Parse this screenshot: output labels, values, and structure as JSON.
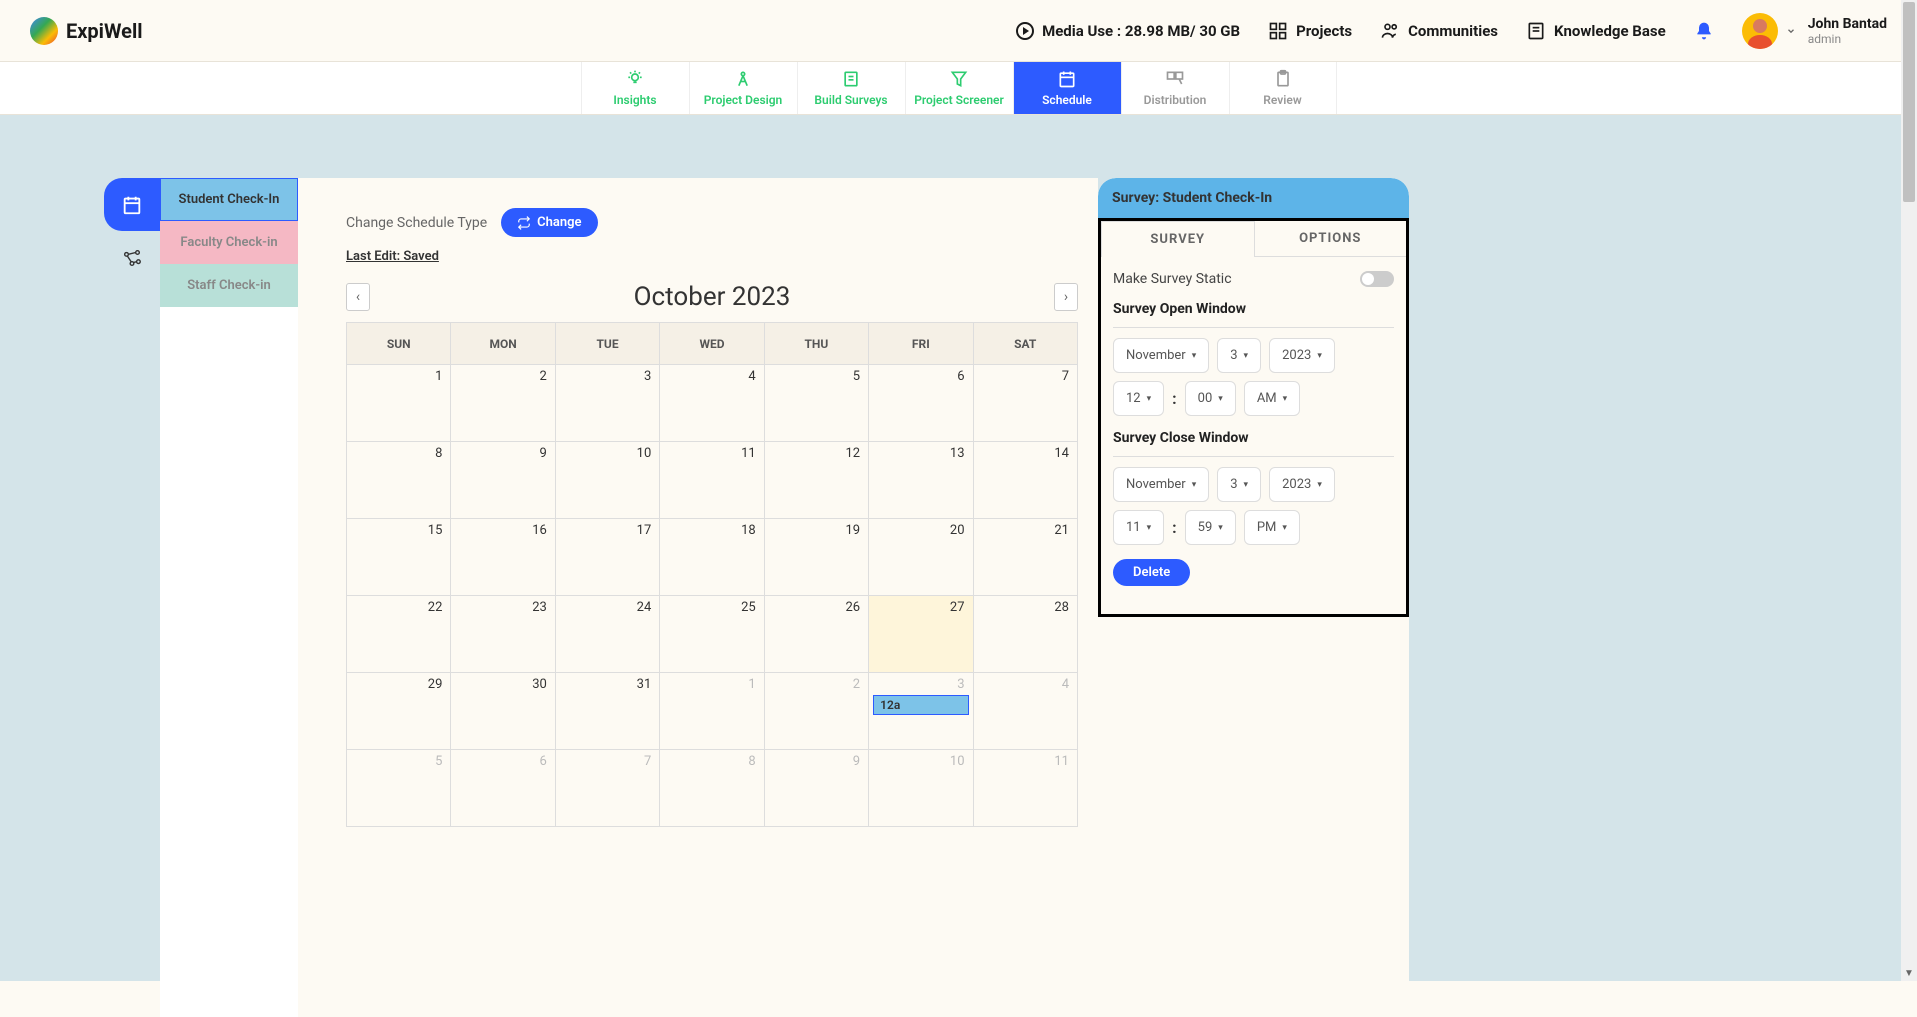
{
  "brand": "ExpiWell",
  "top": {
    "media_use": "Media Use : 28.98 MB/ 30 GB",
    "projects": "Projects",
    "communities": "Communities",
    "knowledge_base": "Knowledge Base"
  },
  "user": {
    "name": "John Bantad",
    "role": "admin"
  },
  "subnav": {
    "insights": "Insights",
    "project_design": "Project Design",
    "build_surveys": "Build Surveys",
    "project_screener": "Project Screener",
    "schedule": "Schedule",
    "distribution": "Distribution",
    "review": "Review"
  },
  "survey_list": {
    "s1": "Student Check-In",
    "s2": "Faculty Check-in",
    "s3": "Staff Check-in"
  },
  "sched": {
    "change_label": "Change Schedule Type",
    "change_btn": "Change",
    "last_edit": "Last Edit: Saved"
  },
  "calendar": {
    "title": "October 2023",
    "prev": "‹",
    "next": "›",
    "days": [
      "SUN",
      "MON",
      "TUE",
      "WED",
      "THU",
      "FRI",
      "SAT"
    ],
    "weeks": [
      [
        {
          "n": "1"
        },
        {
          "n": "2"
        },
        {
          "n": "3"
        },
        {
          "n": "4"
        },
        {
          "n": "5"
        },
        {
          "n": "6"
        },
        {
          "n": "7"
        }
      ],
      [
        {
          "n": "8"
        },
        {
          "n": "9"
        },
        {
          "n": "10"
        },
        {
          "n": "11"
        },
        {
          "n": "12"
        },
        {
          "n": "13"
        },
        {
          "n": "14"
        }
      ],
      [
        {
          "n": "15"
        },
        {
          "n": "16"
        },
        {
          "n": "17"
        },
        {
          "n": "18"
        },
        {
          "n": "19"
        },
        {
          "n": "20"
        },
        {
          "n": "21"
        }
      ],
      [
        {
          "n": "22"
        },
        {
          "n": "23"
        },
        {
          "n": "24"
        },
        {
          "n": "25"
        },
        {
          "n": "26"
        },
        {
          "n": "27",
          "today": true
        },
        {
          "n": "28"
        }
      ],
      [
        {
          "n": "29"
        },
        {
          "n": "30"
        },
        {
          "n": "31"
        },
        {
          "n": "1",
          "faded": true
        },
        {
          "n": "2",
          "faded": true
        },
        {
          "n": "3",
          "faded": true,
          "event": "12a"
        },
        {
          "n": "4",
          "faded": true
        }
      ],
      [
        {
          "n": "5",
          "faded": true
        },
        {
          "n": "6",
          "faded": true
        },
        {
          "n": "7",
          "faded": true
        },
        {
          "n": "8",
          "faded": true
        },
        {
          "n": "9",
          "faded": true
        },
        {
          "n": "10",
          "faded": true
        },
        {
          "n": "11",
          "faded": true
        }
      ]
    ]
  },
  "panel": {
    "header": "Survey: Student Check-In",
    "tab_survey": "SURVEY",
    "tab_options": "OPTIONS",
    "make_static": "Make Survey Static",
    "open_window": "Survey Open Window",
    "close_window": "Survey Close Window",
    "open": {
      "month": "November",
      "day": "3",
      "year": "2023",
      "hour": "12",
      "min": "00",
      "ampm": "AM"
    },
    "close": {
      "month": "November",
      "day": "3",
      "year": "2023",
      "hour": "11",
      "min": "59",
      "ampm": "PM"
    },
    "delete": "Delete"
  }
}
